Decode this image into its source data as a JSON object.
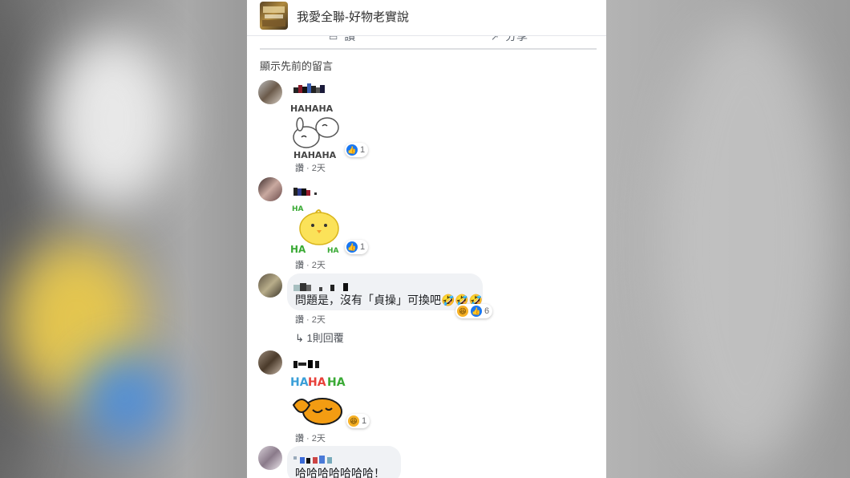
{
  "page": {
    "name": "我愛全聯-好物老實說",
    "action_like": "讚",
    "action_share": "分享",
    "show_previous": "顯示先前的留言"
  },
  "comments": [
    {
      "sticker": "haha-bunny-sticker",
      "reaction_count": "1",
      "like": "讚",
      "time": "2天"
    },
    {
      "sticker": "haha-chick-sticker",
      "reaction_count": "1",
      "like": "讚",
      "time": "2天"
    },
    {
      "text": "問題是，沒有「貞操」可換吧🤣🤣🤣",
      "reaction_count": "6",
      "like": "讚",
      "time": "2天",
      "replies": "1則回覆"
    },
    {
      "sticker": "haha-laughing-cat-sticker",
      "reaction_count": "1",
      "like": "讚",
      "time": "2天"
    },
    {
      "text": "哈哈哈哈哈哈哈！"
    }
  ],
  "sticker_text": {
    "haha": "HAHAHA",
    "ha": "HA"
  },
  "colors": {
    "like_blue": "#1877f2",
    "haha_yellow": "#f7b125",
    "bubble": "#f0f2f5"
  }
}
